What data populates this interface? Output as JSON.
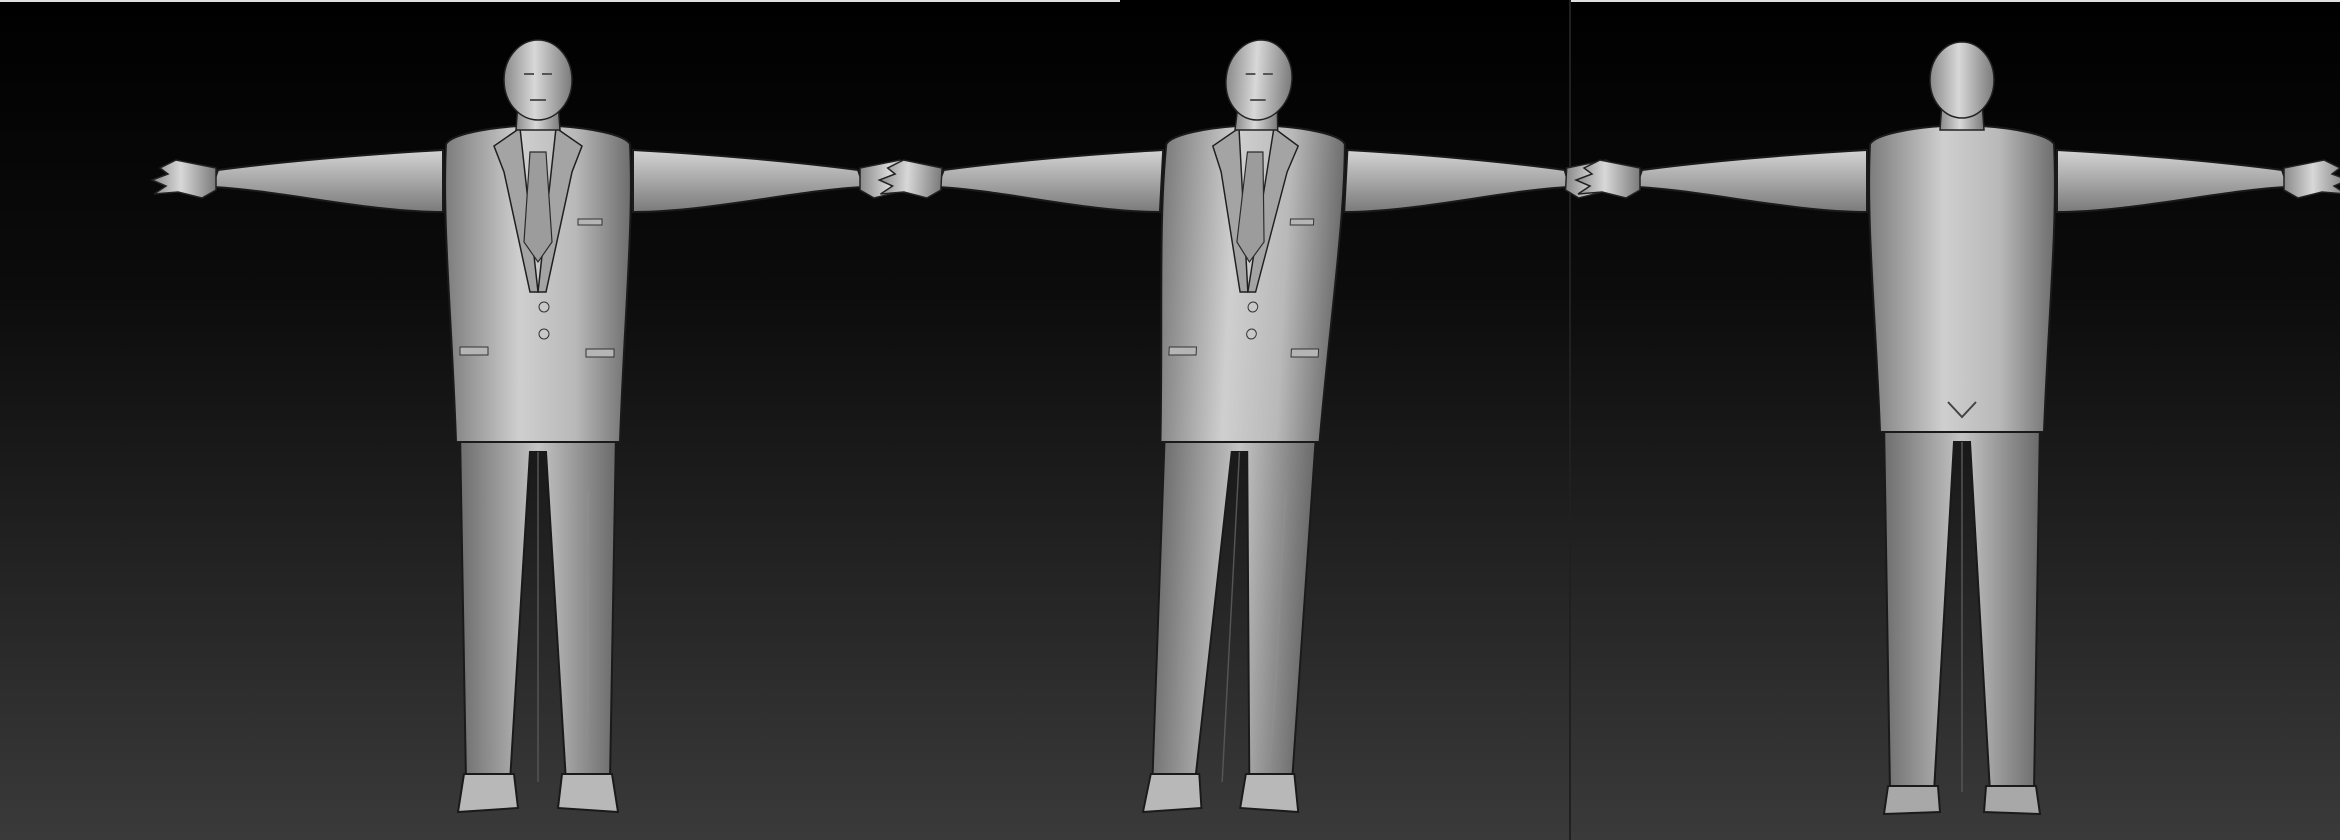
{
  "scene": {
    "panels": [
      {
        "view": "front"
      },
      {
        "view": "three-quarter"
      },
      {
        "view": "back"
      }
    ],
    "colors": {
      "background_top": "#000000",
      "background_bottom": "#3a3a3a",
      "separator": "#ffffff",
      "model_light": "#d6d6d6",
      "model_mid": "#a8a8a8",
      "model_dark": "#5a5a5a",
      "outline": "#1a1a1a"
    }
  }
}
